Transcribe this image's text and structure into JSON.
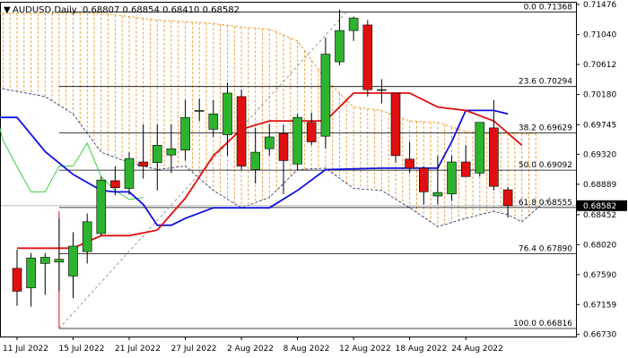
{
  "header": {
    "symbol": "AUDUSD,Daily",
    "ohlc": "0.68807 0.68854 0.68410 0.68582"
  },
  "chart_data": {
    "type": "candlestick",
    "timeframe": "Daily",
    "symbol": "AUDUSD",
    "ylim": [
      0.667,
      0.715
    ],
    "grid": false,
    "colors": {
      "bull": "#2db32d",
      "bear": "#e01010",
      "tenkan": "#e01010",
      "kijun": "#1010e0",
      "chikou": "#40d040",
      "cloud": "#f0a040",
      "fibo": "#000000",
      "current_price_bg": "#000000"
    },
    "y_ticks": [
      "0.71476",
      "0.71040",
      "0.70612",
      "0.70180",
      "0.69745",
      "0.69320",
      "0.68889",
      "0.68452",
      "0.68020",
      "0.67590",
      "0.67159",
      "0.66730"
    ],
    "current_price": "0.68582",
    "x_labels": [
      {
        "label": "11 Jul 2022",
        "i": 0
      },
      {
        "label": "15 Jul 2022",
        "i": 4
      },
      {
        "label": "21 Jul 2022",
        "i": 8
      },
      {
        "label": "27 Jul 2022",
        "i": 12
      },
      {
        "label": "2 Aug 2022",
        "i": 16
      },
      {
        "label": "8 Aug 2022",
        "i": 20
      },
      {
        "label": "12 Aug 2022",
        "i": 24
      },
      {
        "label": "18 Aug 2022",
        "i": 28
      },
      {
        "label": "24 Aug 2022",
        "i": 32
      }
    ],
    "candles": [
      {
        "o": 0.6768,
        "h": 0.6795,
        "l": 0.6714,
        "c": 0.6735
      },
      {
        "o": 0.674,
        "h": 0.679,
        "l": 0.6713,
        "c": 0.6783
      },
      {
        "o": 0.6775,
        "h": 0.679,
        "l": 0.673,
        "c": 0.6784
      },
      {
        "o": 0.6777,
        "h": 0.684,
        "l": 0.6735,
        "c": 0.6781
      },
      {
        "o": 0.6757,
        "h": 0.682,
        "l": 0.6725,
        "c": 0.68
      },
      {
        "o": 0.6792,
        "h": 0.6847,
        "l": 0.6775,
        "c": 0.6835
      },
      {
        "o": 0.6818,
        "h": 0.69,
        "l": 0.6815,
        "c": 0.6895
      },
      {
        "o": 0.6894,
        "h": 0.6915,
        "l": 0.6873,
        "c": 0.6884
      },
      {
        "o": 0.6883,
        "h": 0.6935,
        "l": 0.6874,
        "c": 0.6926
      },
      {
        "o": 0.6921,
        "h": 0.6975,
        "l": 0.6897,
        "c": 0.6915
      },
      {
        "o": 0.692,
        "h": 0.6975,
        "l": 0.688,
        "c": 0.6945
      },
      {
        "o": 0.6931,
        "h": 0.6975,
        "l": 0.6905,
        "c": 0.694
      },
      {
        "o": 0.6938,
        "h": 0.701,
        "l": 0.6923,
        "c": 0.6985
      },
      {
        "o": 0.6995,
        "h": 0.7012,
        "l": 0.698,
        "c": 0.6995
      },
      {
        "o": 0.6968,
        "h": 0.701,
        "l": 0.6957,
        "c": 0.699
      },
      {
        "o": 0.696,
        "h": 0.7035,
        "l": 0.693,
        "c": 0.702
      },
      {
        "o": 0.7015,
        "h": 0.7025,
        "l": 0.691,
        "c": 0.6915
      },
      {
        "o": 0.691,
        "h": 0.697,
        "l": 0.689,
        "c": 0.6935
      },
      {
        "o": 0.694,
        "h": 0.6975,
        "l": 0.693,
        "c": 0.6957
      },
      {
        "o": 0.6962,
        "h": 0.6975,
        "l": 0.6875,
        "c": 0.6923
      },
      {
        "o": 0.6918,
        "h": 0.699,
        "l": 0.691,
        "c": 0.6985
      },
      {
        "o": 0.6978,
        "h": 0.6992,
        "l": 0.6945,
        "c": 0.695
      },
      {
        "o": 0.6958,
        "h": 0.71,
        "l": 0.694,
        "c": 0.7076
      },
      {
        "o": 0.7065,
        "h": 0.714,
        "l": 0.706,
        "c": 0.711
      },
      {
        "o": 0.711,
        "h": 0.713,
        "l": 0.7095,
        "c": 0.7128
      },
      {
        "o": 0.7118,
        "h": 0.7125,
        "l": 0.7015,
        "c": 0.7025
      },
      {
        "o": 0.7025,
        "h": 0.704,
        "l": 0.7005,
        "c": 0.7025
      },
      {
        "o": 0.702,
        "h": 0.702,
        "l": 0.692,
        "c": 0.693
      },
      {
        "o": 0.6925,
        "h": 0.695,
        "l": 0.6905,
        "c": 0.6912
      },
      {
        "o": 0.6912,
        "h": 0.6915,
        "l": 0.686,
        "c": 0.6878
      },
      {
        "o": 0.6872,
        "h": 0.693,
        "l": 0.686,
        "c": 0.6877
      },
      {
        "o": 0.6875,
        "h": 0.693,
        "l": 0.6865,
        "c": 0.6921
      },
      {
        "o": 0.6921,
        "h": 0.6945,
        "l": 0.69,
        "c": 0.69
      },
      {
        "o": 0.6905,
        "h": 0.6978,
        "l": 0.69,
        "c": 0.6978
      },
      {
        "o": 0.697,
        "h": 0.701,
        "l": 0.688,
        "c": 0.6886
      },
      {
        "o": 0.6881,
        "h": 0.6885,
        "l": 0.6841,
        "c": 0.6858
      }
    ],
    "ichimoku": {
      "tenkan": [
        [
          0,
          0.6797
        ],
        [
          4,
          0.6797
        ],
        [
          6,
          0.6815
        ],
        [
          8,
          0.6815
        ],
        [
          10,
          0.6823
        ],
        [
          12,
          0.6869
        ],
        [
          14,
          0.693
        ],
        [
          16,
          0.6968
        ],
        [
          18,
          0.698
        ],
        [
          22,
          0.698
        ],
        [
          24,
          0.702
        ],
        [
          26,
          0.702
        ],
        [
          28,
          0.702
        ],
        [
          30,
          0.7
        ],
        [
          32,
          0.6995
        ],
        [
          34,
          0.698
        ],
        [
          36,
          0.6945
        ]
      ],
      "kijun": [
        [
          -2,
          0.6985
        ],
        [
          0,
          0.6985
        ],
        [
          2,
          0.6936
        ],
        [
          4,
          0.6903
        ],
        [
          6,
          0.688
        ],
        [
          7,
          0.6878
        ],
        [
          8,
          0.6878
        ],
        [
          9,
          0.686
        ],
        [
          10,
          0.683
        ],
        [
          11,
          0.683
        ],
        [
          12,
          0.684
        ],
        [
          14,
          0.6855
        ],
        [
          18,
          0.6855
        ],
        [
          20,
          0.688
        ],
        [
          22,
          0.691
        ],
        [
          26,
          0.6912
        ],
        [
          30,
          0.6912
        ],
        [
          31,
          0.695
        ],
        [
          32,
          0.6995
        ],
        [
          34,
          0.6995
        ],
        [
          35,
          0.699
        ]
      ],
      "chikou": [
        [
          -2,
          0.703
        ],
        [
          -1,
          0.6952
        ],
        [
          0,
          0.6914
        ],
        [
          1,
          0.6878
        ],
        [
          2,
          0.6878
        ],
        [
          3,
          0.6915
        ],
        [
          4,
          0.6915
        ],
        [
          5,
          0.6948
        ],
        [
          6,
          0.69
        ],
        [
          7,
          0.688
        ],
        [
          8,
          0.6867
        ],
        [
          9,
          0.687
        ]
      ],
      "span_a": [
        [
          -2,
          0.7135
        ],
        [
          6,
          0.7135
        ],
        [
          10,
          0.7125
        ],
        [
          14,
          0.712
        ],
        [
          16,
          0.7115
        ],
        [
          18,
          0.7112
        ],
        [
          20,
          0.7095
        ],
        [
          22,
          0.704
        ],
        [
          24,
          0.7
        ],
        [
          26,
          0.6995
        ],
        [
          28,
          0.698
        ],
        [
          30,
          0.6978
        ],
        [
          32,
          0.6965
        ],
        [
          34,
          0.6962
        ],
        [
          37,
          0.6962
        ]
      ],
      "span_b": [
        [
          -2,
          0.703
        ],
        [
          2,
          0.7015
        ],
        [
          4,
          0.699
        ],
        [
          6,
          0.6935
        ],
        [
          8,
          0.692
        ],
        [
          10,
          0.691
        ],
        [
          12,
          0.6915
        ],
        [
          14,
          0.688
        ],
        [
          16,
          0.6855
        ],
        [
          18,
          0.687
        ],
        [
          20,
          0.691
        ],
        [
          22,
          0.6912
        ],
        [
          24,
          0.6883
        ],
        [
          26,
          0.688
        ],
        [
          28,
          0.6855
        ],
        [
          30,
          0.6828
        ],
        [
          32,
          0.684
        ],
        [
          34,
          0.685
        ],
        [
          35,
          0.6845
        ],
        [
          36,
          0.6835
        ],
        [
          38,
          0.687
        ]
      ]
    },
    "fibonacci": [
      {
        "label": "0.0 0.71368",
        "value": 0.71368
      },
      {
        "label": "23.6 0.70294",
        "value": 0.70294
      },
      {
        "label": "38.2 0.69629",
        "value": 0.69629
      },
      {
        "label": "50.0 0.69092",
        "value": 0.69092
      },
      {
        "label": "61.8 0.68555",
        "value": 0.68555
      },
      {
        "label": "76.4 0.67890",
        "value": 0.6789
      },
      {
        "label": "100.0 0.66816",
        "value": 0.66816
      }
    ]
  }
}
